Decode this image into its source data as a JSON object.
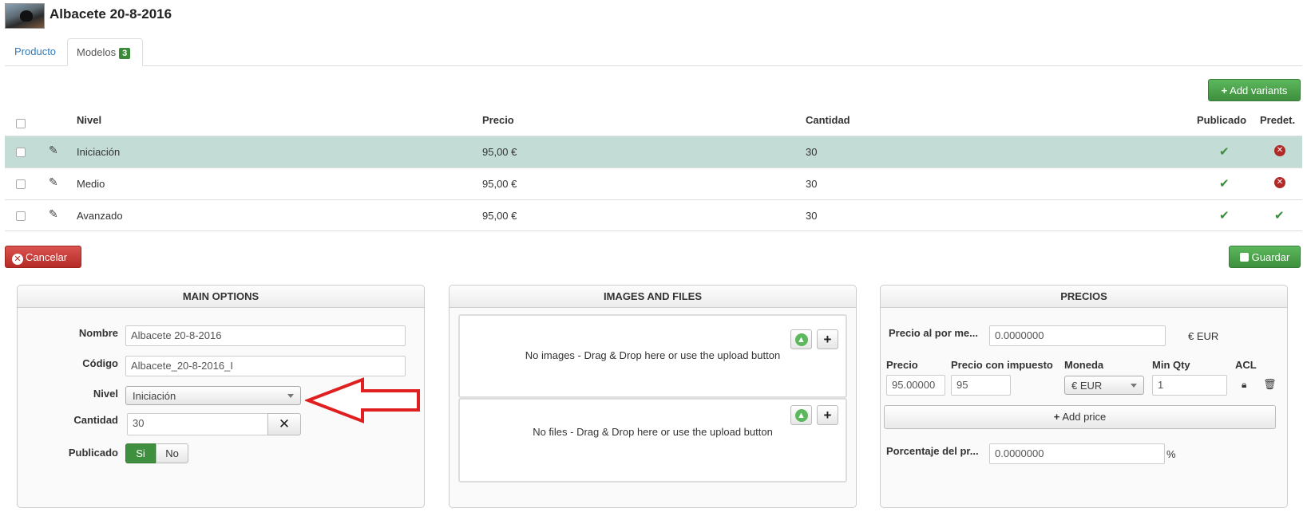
{
  "header": {
    "title": "Albacete 20-8-2016"
  },
  "tabs": [
    {
      "label": "Producto"
    },
    {
      "label": "Modelos",
      "badge": "3"
    }
  ],
  "toolbar": {
    "add_variants": "Add variants",
    "cancel": "Cancelar",
    "save": "Guardar"
  },
  "table": {
    "columns": {
      "nivel": "Nivel",
      "precio": "Precio",
      "cantidad": "Cantidad",
      "publicado": "Publicado",
      "predet": "Predet."
    },
    "rows": [
      {
        "nivel": "Iniciación",
        "precio": "95,00 €",
        "cantidad": "30",
        "publicado": "yes",
        "predet": "no",
        "selected": true
      },
      {
        "nivel": "Medio",
        "precio": "95,00 €",
        "cantidad": "30",
        "publicado": "yes",
        "predet": "no",
        "selected": false
      },
      {
        "nivel": "Avanzado",
        "precio": "95,00 €",
        "cantidad": "30",
        "publicado": "yes",
        "predet": "yes",
        "selected": false
      }
    ]
  },
  "main_options": {
    "title": "MAIN OPTIONS",
    "nombre_label": "Nombre",
    "nombre_value": "Albacete 20-8-2016",
    "codigo_label": "Código",
    "codigo_value": "Albacete_20-8-2016_I",
    "nivel_label": "Nivel",
    "nivel_value": "Iniciación",
    "cantidad_label": "Cantidad",
    "cantidad_value": "30",
    "publicado_label": "Publicado",
    "publicado_si": "Si",
    "publicado_no": "No"
  },
  "images_files": {
    "title": "IMAGES AND FILES",
    "images_text": "No images - Drag & Drop here or use the upload button",
    "files_text": "No files - Drag & Drop here or use the upload button"
  },
  "precios": {
    "title": "PRECIOS",
    "por_mayor_label": "Precio al por me...",
    "por_mayor_value": "0.0000000",
    "por_mayor_currency": "€ EUR",
    "precio_label": "Precio",
    "precio_value": "95.00000",
    "impuesto_label": "Precio con impuesto",
    "impuesto_value": "95",
    "moneda_label": "Moneda",
    "moneda_value": "€ EUR",
    "minqty_label": "Min Qty",
    "minqty_value": "1",
    "acl_label": "ACL",
    "add_price": "Add price",
    "porcentaje_label": "Porcentaje del pr...",
    "porcentaje_value": "0.0000000",
    "porcentaje_unit": "%"
  },
  "colors": {
    "green": "#3e8f3e",
    "red": "#b52b27",
    "selected_row": "#c3dcd6",
    "link": "#337ab7"
  },
  "icons": [
    "pencil-icon",
    "check-icon",
    "times-circle-icon",
    "upload-icon",
    "plus-icon",
    "lock-icon",
    "trash-icon",
    "save-icon",
    "cancel-icon"
  ]
}
